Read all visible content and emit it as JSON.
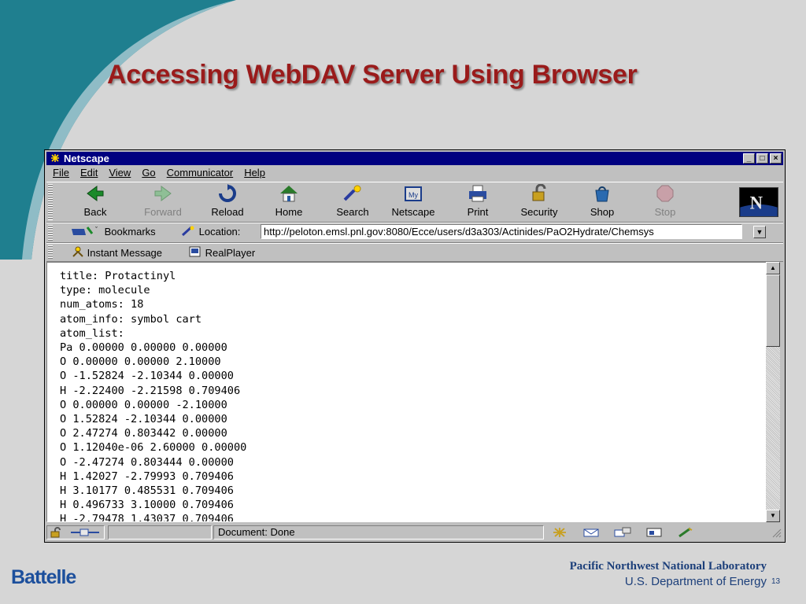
{
  "slide": {
    "title": "Accessing WebDAV Server Using Browser",
    "footer_logo": "Battelle",
    "footer_lab": "Pacific Northwest National Laboratory",
    "footer_doe": "U.S. Department of Energy",
    "page_number": "13"
  },
  "window": {
    "title": "Netscape",
    "buttons": [
      "minimize",
      "maximize",
      "close"
    ]
  },
  "menu": [
    "File",
    "Edit",
    "View",
    "Go",
    "Communicator",
    "Help"
  ],
  "toolbar": [
    {
      "label": "Back",
      "icon": "back-icon",
      "enabled": true
    },
    {
      "label": "Forward",
      "icon": "forward-icon",
      "enabled": false
    },
    {
      "label": "Reload",
      "icon": "reload-icon",
      "enabled": true
    },
    {
      "label": "Home",
      "icon": "home-icon",
      "enabled": true
    },
    {
      "label": "Search",
      "icon": "search-icon",
      "enabled": true
    },
    {
      "label": "Netscape",
      "icon": "netscape-icon",
      "enabled": true
    },
    {
      "label": "Print",
      "icon": "print-icon",
      "enabled": true
    },
    {
      "label": "Security",
      "icon": "security-icon",
      "enabled": true
    },
    {
      "label": "Shop",
      "icon": "shop-icon",
      "enabled": true
    },
    {
      "label": "Stop",
      "icon": "stop-icon",
      "enabled": false
    }
  ],
  "location": {
    "bookmarks_label": "Bookmarks",
    "location_label": "Location:",
    "url": "http://peloton.emsl.pnl.gov:8080/Ecce/users/d3a303/Actinides/PaO2Hydrate/Chemsys"
  },
  "personal_toolbar": {
    "instant_message": "Instant Message",
    "realplayer": "RealPlayer"
  },
  "content_lines": [
    "title: Protactinyl",
    "type: molecule",
    "num_atoms: 18",
    "atom_info: symbol cart",
    "atom_list:",
    "Pa 0.00000 0.00000 0.00000",
    "O 0.00000 0.00000 2.10000",
    "O -1.52824 -2.10344 0.00000",
    "H -2.22400 -2.21598 0.709406",
    "O 0.00000 0.00000 -2.10000",
    "O 1.52824 -2.10344 0.00000",
    "O 2.47274 0.803442 0.00000",
    "O 1.12040e-06 2.60000 0.00000",
    "O -2.47274 0.803444 0.00000",
    "H 1.42027 -2.79993 0.709406",
    "H 3.10177 0.485531 0.709406",
    "H 0.496733 3.10000 0.709406",
    "H -2.79478 1.43037 0.709406"
  ],
  "status": {
    "text": "Document: Done"
  },
  "colors": {
    "title_red": "#9a1b1b",
    "titlebar_blue": "#000080",
    "footer_blue": "#1c3f7a",
    "swoosh_teal": "#1f7f8f"
  }
}
